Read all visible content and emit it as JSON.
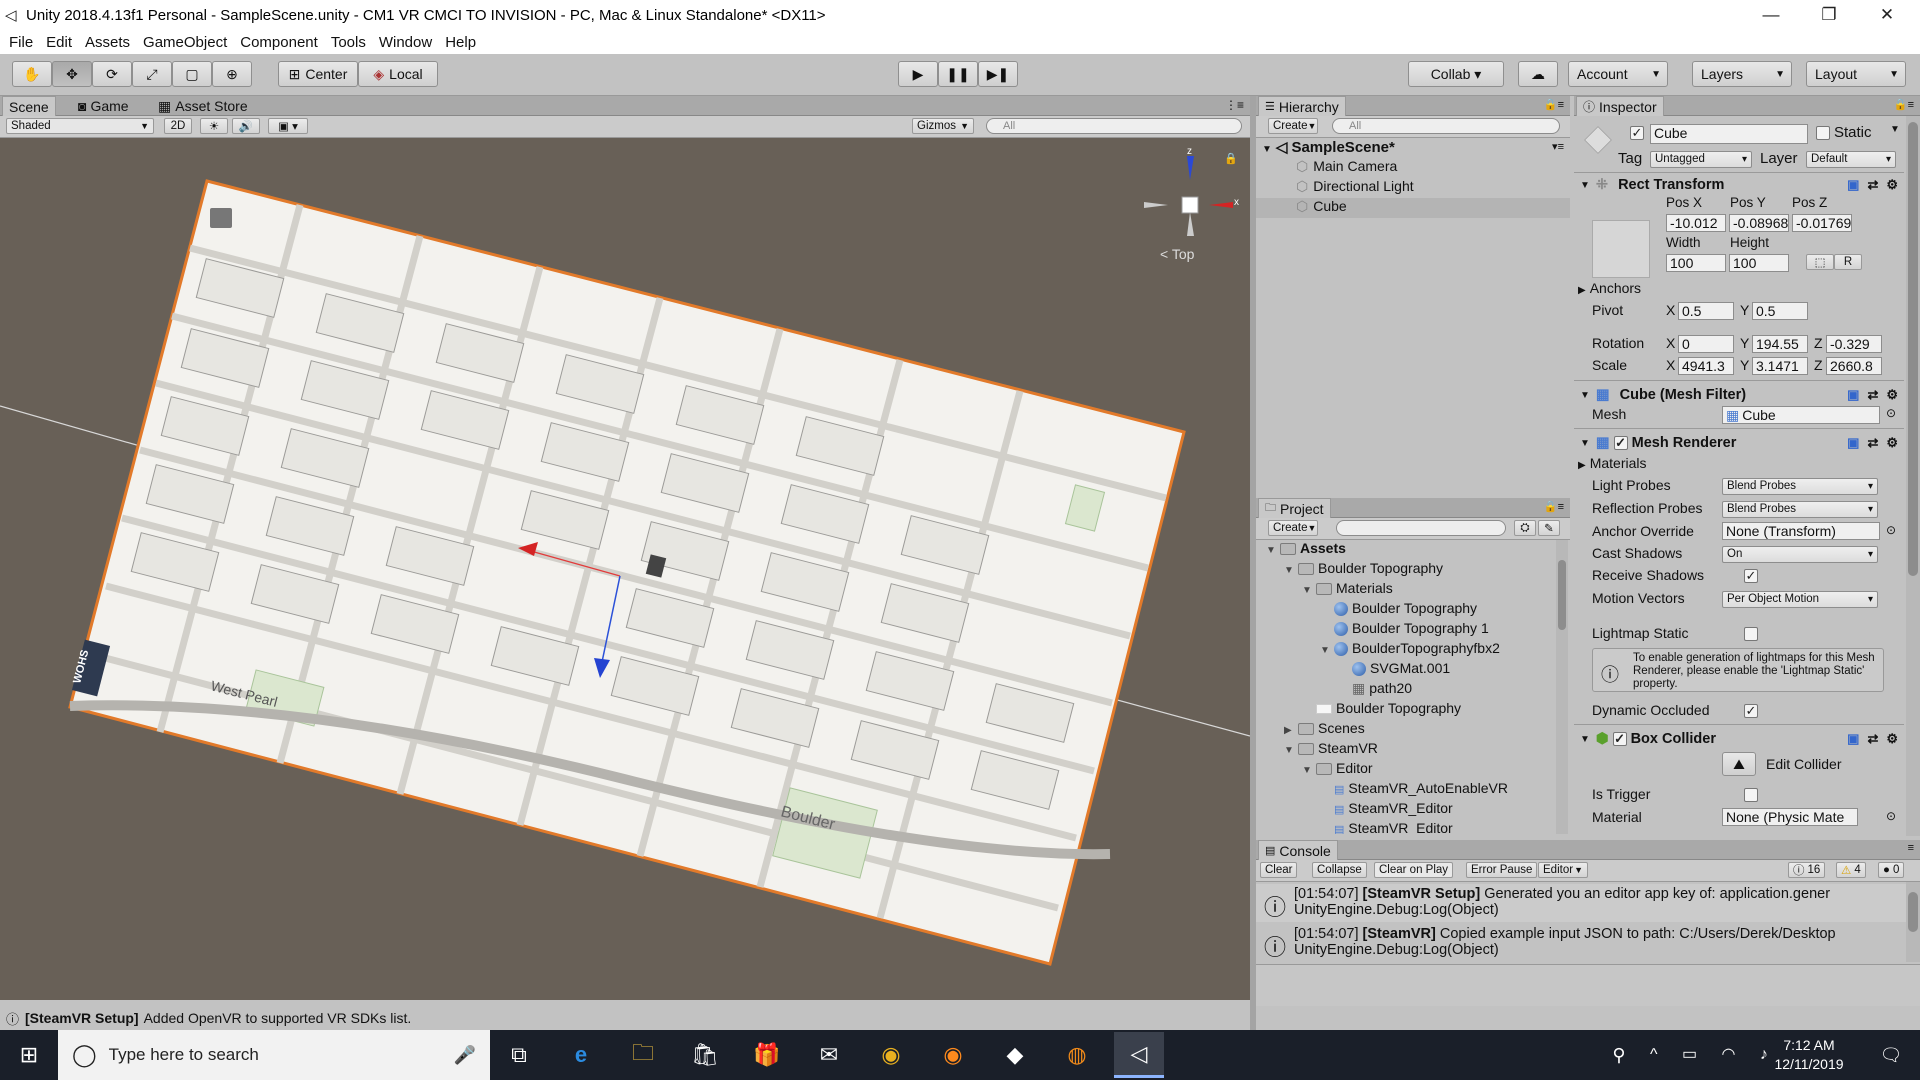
{
  "window": {
    "title": "Unity 2018.4.13f1 Personal - SampleScene.unity - CM1 VR CMCI TO INVISION - PC, Mac & Linux Standalone* <DX11>",
    "minimize": "—",
    "restore": "❐",
    "close": "✕"
  },
  "menu": [
    "File",
    "Edit",
    "Assets",
    "GameObject",
    "Component",
    "Tools",
    "Window",
    "Help"
  ],
  "toolbar": {
    "center": "Center",
    "local": "Local",
    "collab": "Collab ▾",
    "account": "Account",
    "layers": "Layers",
    "layout": "Layout"
  },
  "scene_tabs": {
    "scene": "Scene",
    "game": "Game",
    "asset_store": "Asset Store"
  },
  "scene_bar": {
    "shading": "Shaded",
    "mode2d": "2D",
    "gizmos": "Gizmos",
    "search": "All"
  },
  "gizmo": {
    "view": "< Top",
    "y": "z",
    "x": "x"
  },
  "map": {
    "street": "Boulder",
    "west": "West Pearl",
    "logo": "WOHS"
  },
  "hierarchy": {
    "title": "Hierarchy",
    "create": "Create",
    "search": "All",
    "scene": "SampleScene*",
    "items": [
      "Main Camera",
      "Directional Light",
      "Cube"
    ]
  },
  "project": {
    "title": "Project",
    "create": "Create",
    "items": [
      {
        "label": "Assets",
        "indent": 0,
        "kind": "root"
      },
      {
        "label": "Boulder Topography",
        "indent": 1,
        "kind": "folder"
      },
      {
        "label": "Materials",
        "indent": 2,
        "kind": "folder"
      },
      {
        "label": "Boulder Topography",
        "indent": 3,
        "kind": "mat"
      },
      {
        "label": "Boulder Topography 1",
        "indent": 3,
        "kind": "mat"
      },
      {
        "label": "BoulderTopographyfbx2",
        "indent": 3,
        "kind": "model"
      },
      {
        "label": "SVGMat.001",
        "indent": 4,
        "kind": "mat"
      },
      {
        "label": "path20",
        "indent": 4,
        "kind": "grid"
      },
      {
        "label": "Boulder Topography",
        "indent": 2,
        "kind": "plane"
      },
      {
        "label": "Scenes",
        "indent": 1,
        "kind": "folder"
      },
      {
        "label": "SteamVR",
        "indent": 1,
        "kind": "folder"
      },
      {
        "label": "Editor",
        "indent": 2,
        "kind": "folder"
      },
      {
        "label": "SteamVR_AutoEnableVR",
        "indent": 3,
        "kind": "cs"
      },
      {
        "label": "SteamVR_Editor",
        "indent": 3,
        "kind": "cs"
      },
      {
        "label": "SteamVR_Editor",
        "indent": 3,
        "kind": "cs"
      }
    ]
  },
  "inspector": {
    "title": "Inspector",
    "name": "Cube",
    "static": "Static",
    "tag_label": "Tag",
    "tag": "Untagged",
    "layer_label": "Layer",
    "layer": "Default",
    "rect": {
      "title": "Rect Transform",
      "posx_l": "Pos X",
      "posy_l": "Pos Y",
      "posz_l": "Pos Z",
      "posx": "-10.012",
      "posy": "-0.08968",
      "posz": "-0.01769",
      "w_l": "Width",
      "h_l": "Height",
      "w": "100",
      "h": "100",
      "r": "R",
      "anchors": "Anchors",
      "pivot": "Pivot",
      "px": "0.5",
      "py": "0.5",
      "rotation": "Rotation",
      "rx": "0",
      "ry": "194.55",
      "rz": "-0.329",
      "scale": "Scale",
      "sx": "4941.3",
      "sy": "3.1471",
      "sz": "2660.8",
      "X": "X",
      "Y": "Y",
      "Z": "Z"
    },
    "meshfilter": {
      "title": "Cube (Mesh Filter)",
      "mesh_l": "Mesh",
      "mesh": "Cube"
    },
    "renderer": {
      "title": "Mesh Renderer",
      "materials": "Materials",
      "light_probes_l": "Light Probes",
      "light_probes": "Blend Probes",
      "refl_l": "Reflection Probes",
      "refl": "Blend Probes",
      "anchor_l": "Anchor Override",
      "anchor": "None (Transform)",
      "cast_l": "Cast Shadows",
      "cast": "On",
      "receive_l": "Receive Shadows",
      "motion_l": "Motion Vectors",
      "motion": "Per Object Motion",
      "lightmap_l": "Lightmap Static",
      "info": "To enable generation of lightmaps for this Mesh Renderer, please enable the 'Lightmap Static' property.",
      "dyn_l": "Dynamic Occluded"
    },
    "collider": {
      "title": "Box Collider",
      "edit": "Edit Collider",
      "trigger_l": "Is Trigger",
      "material_l": "Material",
      "material": "None (Physic Mate"
    }
  },
  "console": {
    "title": "Console",
    "clear": "Clear",
    "collapse": "Collapse",
    "clear_on_play": "Clear on Play",
    "error_pause": "Error Pause",
    "editor": "Editor",
    "info_count": "16",
    "warn_count": "4",
    "err_count": "0",
    "logs": [
      {
        "time": "[01:54:07]",
        "tag": "[SteamVR Setup]",
        "msg": "Generated you an editor app key of: application.gener",
        "sub": "UnityEngine.Debug:Log(Object)"
      },
      {
        "time": "[01:54:07]",
        "tag": "[SteamVR]",
        "msg": "Copied example input JSON to path: C:/Users/Derek/Desktop",
        "sub": "UnityEngine.Debug:Log(Object)"
      }
    ]
  },
  "status": {
    "tag": "[SteamVR Setup]",
    "msg": "Added OpenVR to supported VR SDKs list."
  },
  "taskbar": {
    "search": "Type here to search",
    "time": "7:12 AM",
    "date": "12/11/2019"
  }
}
